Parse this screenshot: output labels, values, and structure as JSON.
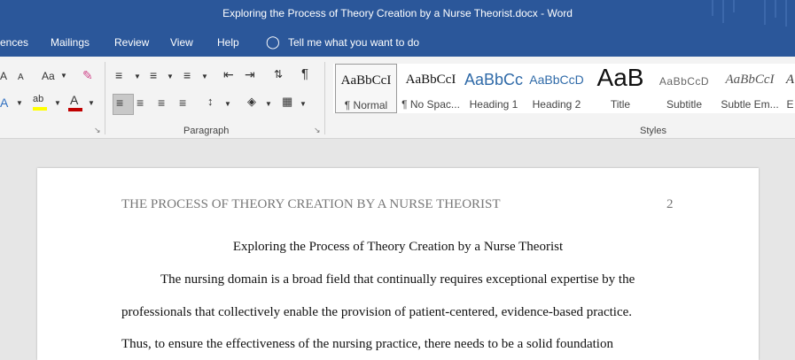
{
  "window": {
    "title": "Exploring the Process of Theory Creation by a Nurse Theorist.docx  -  Word"
  },
  "menu": {
    "items": [
      "ences",
      "Mailings",
      "Review",
      "View",
      "Help"
    ],
    "tell_me": "Tell me what you want to do"
  },
  "ribbon": {
    "font_group": {
      "change_case": "Aa",
      "increase_font": "A",
      "decrease_font": "A"
    },
    "paragraph_label": "Paragraph",
    "styles_label": "Styles",
    "styles": [
      {
        "sample": "AaBbCcI",
        "name": "¶ Normal"
      },
      {
        "sample": "AaBbCcI",
        "name": "¶ No Spac..."
      },
      {
        "sample": "AaBbCc",
        "name": "Heading 1"
      },
      {
        "sample": "AaBbCcD",
        "name": "Heading 2"
      },
      {
        "sample": "AaB",
        "name": "Title"
      },
      {
        "sample": "AaBbCcD",
        "name": "Subtitle"
      },
      {
        "sample": "AaBbCcI",
        "name": "Subtle Em..."
      },
      {
        "sample": "A",
        "name": "E"
      }
    ],
    "colors": {
      "highlight": "#ffff00",
      "font_color": "#c00000"
    }
  },
  "document": {
    "running_head": "THE PROCESS OF THEORY CREATION BY A NURSE THEORIST",
    "page_number": "2",
    "title": "Exploring the Process of Theory Creation by a Nurse Theorist",
    "lines": [
      "The nursing domain is a broad field that continually requires exceptional expertise by the",
      "professionals that collectively enable the provision of patient-centered, evidence-based practice.",
      "Thus, to ensure the effectiveness of the nursing practice, there needs to be a solid foundation"
    ]
  },
  "theme": {
    "accent": "#2b579a",
    "ribbon_bg": "#f3f3f3",
    "canvas_bg": "#e6e6e6"
  }
}
